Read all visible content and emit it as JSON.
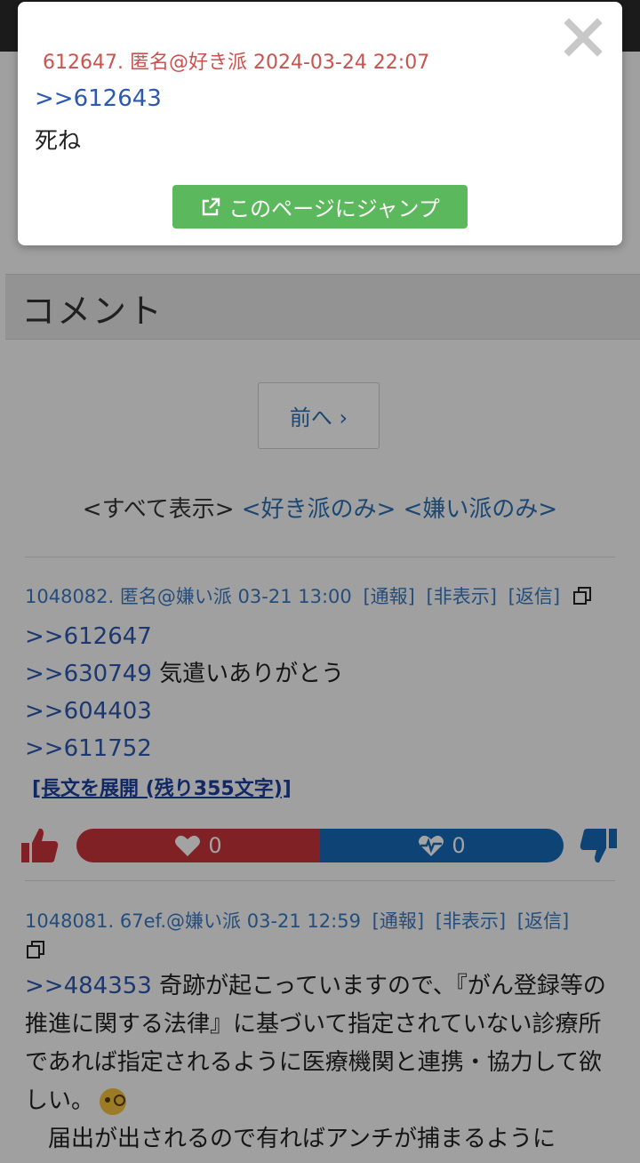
{
  "section": {
    "title": "コメント"
  },
  "pagination": {
    "prev_label": "前へ ›"
  },
  "filters": {
    "all": "<すべて表示>",
    "like_only": "<好き派のみ>",
    "dislike_only": "<嫌い派のみ>"
  },
  "comments": [
    {
      "header": "1048082. 匿名@嫌い派 03-21 13:00",
      "report": "[通報]",
      "hide": "[非表示]",
      "reply": "[返信]",
      "lines": [
        {
          "anchor": ">>612647",
          "text": ""
        },
        {
          "anchor": ">>630749",
          "text": " 気遣いありがとう"
        },
        {
          "anchor": ">>604403",
          "text": ""
        },
        {
          "anchor": ">>611752",
          "text": ""
        }
      ],
      "expand": "[長文を展開 (残り355文字)]",
      "likes": "0",
      "dislikes": "0"
    },
    {
      "header": "1048081. 67ef.@嫌い派 03-21 12:59",
      "report": "[通報]",
      "hide": "[非表示]",
      "reply": "[返信]",
      "anchor": ">>484353",
      "body1": " 奇跡が起こっていますので、『がん登録等の推進に関する法律』に基づいて指定されていない診療所であれば指定されるように医療機関と連携・協力して欲しい。",
      "body2": "　届出が出されるので有ればアンチが捕まるように"
    }
  ],
  "popup": {
    "meta": "612647. 匿名@好き派 2024-03-24 22:07",
    "anchor": ">>612643",
    "body": "死ね",
    "jump_label": "このページにジャンプ"
  },
  "colors": {
    "like": "#c9343a",
    "dislike": "#1669b8",
    "link": "#2c6fb3",
    "popup_meta": "#c9534f",
    "jump_button": "#5cb85c"
  },
  "icons": [
    "thumbs-up-icon",
    "heart-icon",
    "heartbeat-icon",
    "thumbs-down-icon",
    "copy-icon",
    "close-icon",
    "external-link-icon",
    "monocle-face-emoji"
  ]
}
